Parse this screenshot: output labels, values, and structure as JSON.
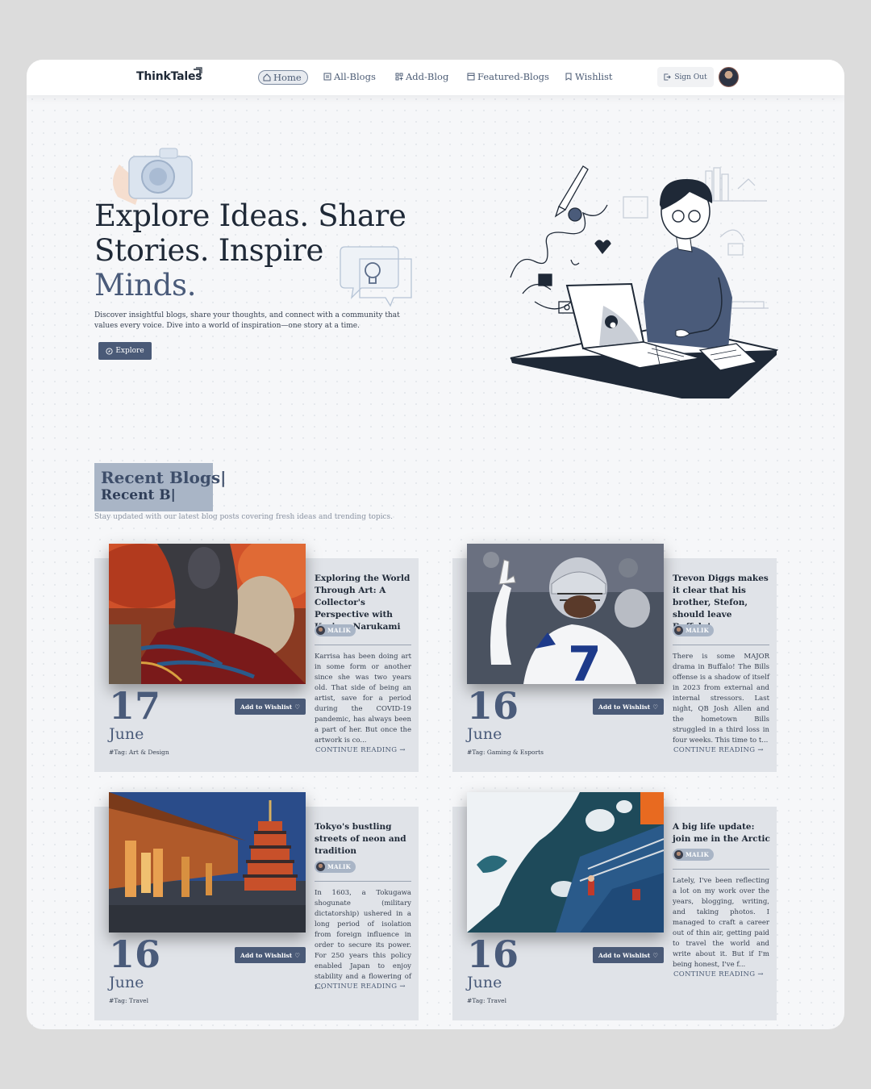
{
  "brand": {
    "name": "ThinkTales"
  },
  "nav": {
    "items": [
      {
        "label": "Home",
        "icon": "home-icon",
        "active": true
      },
      {
        "label": "All-Blogs",
        "icon": "list-icon",
        "active": false
      },
      {
        "label": "Add-Blog",
        "icon": "add-icon",
        "active": false
      },
      {
        "label": "Featured-Blogs",
        "icon": "featured-icon",
        "active": false
      },
      {
        "label": "Wishlist",
        "icon": "bookmark-icon",
        "active": false
      }
    ],
    "signout_label": "Sign Out"
  },
  "hero": {
    "title_line1": "Explore Ideas. Share",
    "title_line2": "Stories. Inspire",
    "title_accent": "Minds.",
    "subtitle": "Discover insightful blogs, share your thoughts, and connect with a community that values every voice. Dive into a world of inspiration—one story at a time.",
    "cta_label": "Explore"
  },
  "recent": {
    "title": "Recent Blogs|",
    "ghost": "Recent B|",
    "subtitle": "Stay updated with our latest blog posts covering fresh ideas and trending topics."
  },
  "cards": [
    {
      "title": "Exploring the World Through Art: A Collector's Perspective with Karissa Narukami",
      "author": "MALIK",
      "excerpt": "Karrisa has been doing art in some form or another since she was two years old. That side of being an artist, save for a period during the COVID-19 pandemic, has always been a part of her. But once the artwork is co...",
      "day": "17",
      "month": "June",
      "tag": "#Tag: Art & Design",
      "wishlist_label": "Add to Wishlist",
      "continue_label": "CONTINUE READING"
    },
    {
      "title": "Trevon Diggs makes it clear that his brother, Stefon, should leave Buffalo!",
      "author": "MALIK",
      "excerpt": "There is some MAJOR drama in Buffalo! The Bills offense is a shadow of itself in 2023 from external and internal stressors. Last night, QB Josh Allen and the hometown Bills struggled in a third loss in four weeks. This time to t...",
      "day": "16",
      "month": "June",
      "tag": "#Tag: Gaming & Esports",
      "wishlist_label": "Add to Wishlist",
      "continue_label": "CONTINUE READING"
    },
    {
      "title": "Tokyo's bustling streets of neon and tradition",
      "author": "MALIK",
      "excerpt": "In 1603, a Tokugawa shogunate (military dictatorship) ushered in a long period of isolation from foreign influence in order to secure its power. For 250 years this policy enabled Japan to enjoy stability and a flowering of i...",
      "day": "16",
      "month": "June",
      "tag": "#Tag: Travel",
      "wishlist_label": "Add to Wishlist",
      "continue_label": "CONTINUE READING"
    },
    {
      "title": "A big life update: join me in the Arctic",
      "author": "MALIK",
      "excerpt": "Lately, I've been reflecting a lot on my work over the years, blogging, writing, and taking photos. I managed to craft a career out of thin air, getting paid to travel the world and write about it. But if I'm being honest, I've f...",
      "day": "16",
      "month": "June",
      "tag": "#Tag: Travel",
      "wishlist_label": "Add to Wishlist",
      "continue_label": "CONTINUE READING"
    }
  ],
  "colors": {
    "accent": "#4a5a77",
    "accent_light": "#a9b5c6",
    "card_bg": "#e0e3e8"
  }
}
